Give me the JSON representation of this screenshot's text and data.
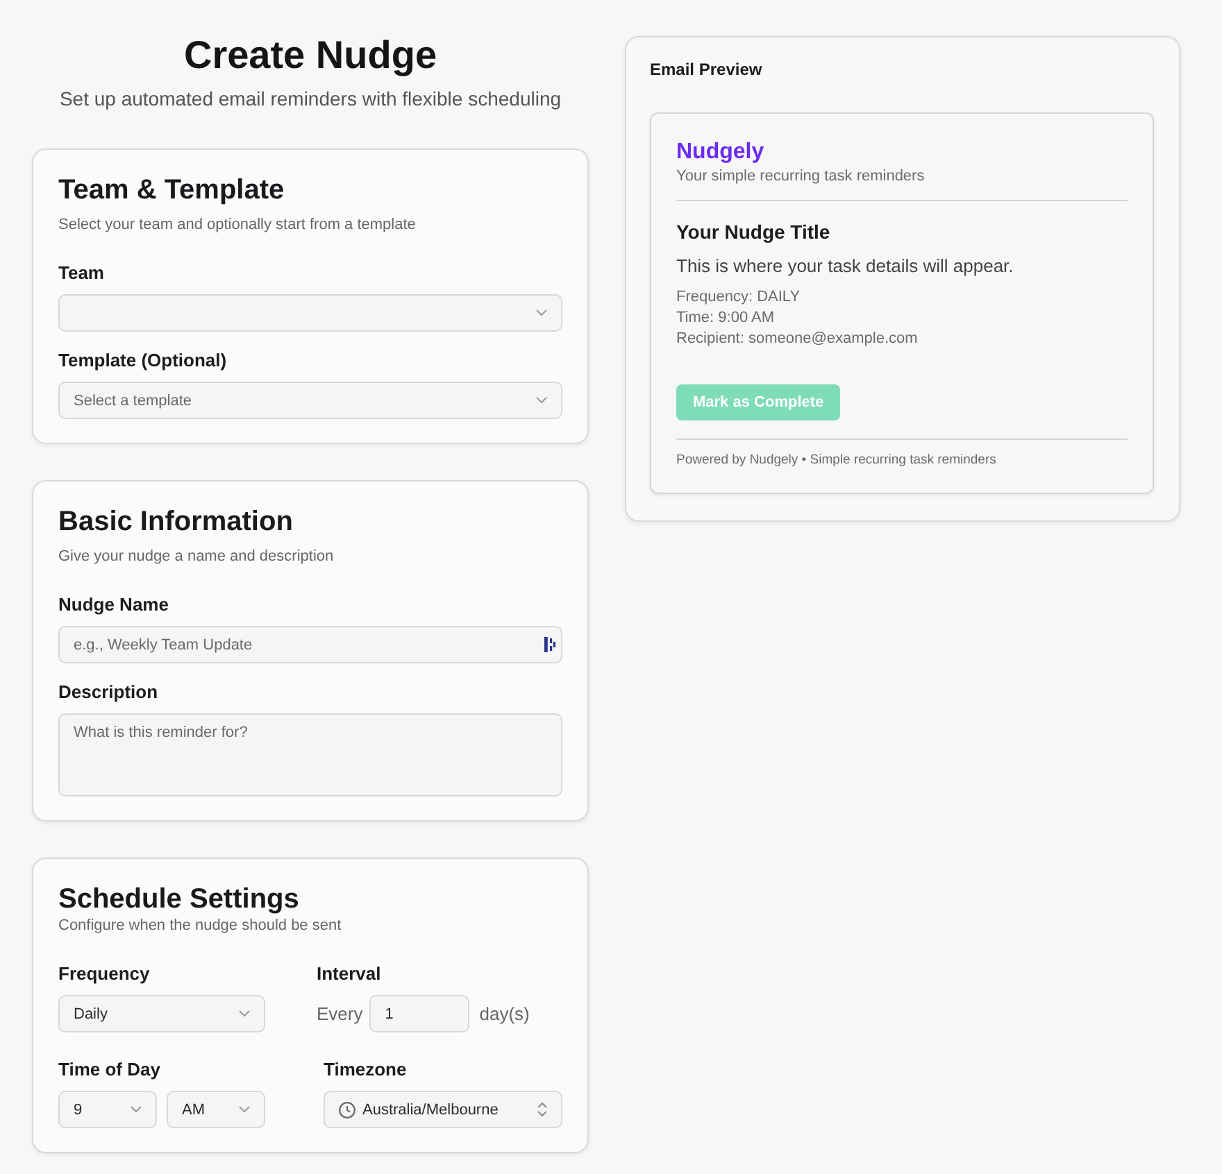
{
  "header": {
    "title": "Create Nudge",
    "subtitle": "Set up automated email reminders with flexible scheduling"
  },
  "sections": [
    {
      "title": "Team & Template",
      "subtitle": "Select your team and optionally start from a template",
      "rows": [
        [
          {
            "label": "Team",
            "controls": [
              {
                "kind": "select"
              }
            ]
          }
        ],
        [
          {
            "label": "Template (Optional)",
            "controls": [
              {
                "kind": "select",
                "placeholder": "Select a template"
              }
            ]
          }
        ]
      ]
    },
    {
      "title": "Basic Information",
      "subtitle": "Give your nudge a name and description",
      "rows": [
        [
          {
            "label": "Nudge Name",
            "controls": [
              {
                "kind": "text",
                "placeholder": "e.g., Weekly Team Update",
                "trailing_icon": true
              }
            ]
          }
        ],
        [
          {
            "label": "Description",
            "controls": [
              {
                "kind": "textarea",
                "placeholder": "What is this reminder for?"
              }
            ]
          }
        ]
      ]
    },
    {
      "title": "Schedule Settings",
      "subtitle": "Configure when the nudge should be sent",
      "rows": [
        [
          {
            "label": "Frequency",
            "controls": [
              {
                "kind": "select",
                "value": "Daily"
              }
            ]
          },
          {
            "label": "Interval",
            "controls": [
              {
                "kind": "number",
                "prefix": "Every",
                "value": "1",
                "suffix": "day(s)"
              }
            ]
          }
        ],
        [
          {
            "label": "Time of Day",
            "controls": [
              {
                "kind": "select",
                "value": "9"
              },
              {
                "kind": "select",
                "value": "AM"
              }
            ]
          },
          {
            "label": "Timezone",
            "controls": [
              {
                "kind": "timezone",
                "value": "Australia/Melbourne"
              }
            ]
          }
        ]
      ]
    }
  ],
  "preview": {
    "title": "Email Preview",
    "brand": "Nudgely",
    "tagline": "Your simple recurring task reminders",
    "nudge_title": "Your Nudge Title",
    "body": "This is where your task details will appear.",
    "details": [
      "Frequency: DAILY",
      "Time: 9:00 AM",
      "Recipient: someone@example.com"
    ],
    "button": "Mark as Complete",
    "footer": "Powered by Nudgely • Simple recurring task reminders"
  }
}
